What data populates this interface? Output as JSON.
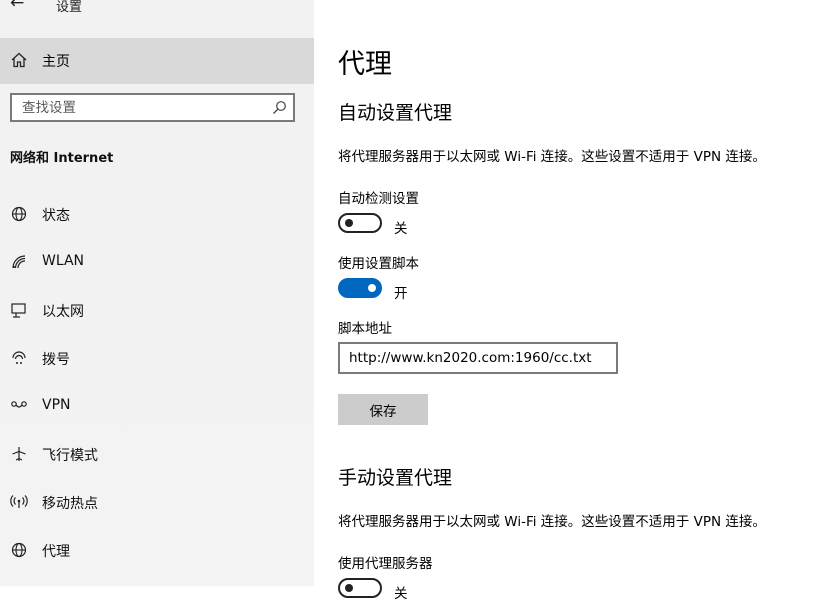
{
  "app": {
    "title": "设置"
  },
  "sidebar": {
    "home_label": "主页",
    "search_placeholder": "查找设置",
    "section_title": "网络和 Internet",
    "items": [
      {
        "label": "状态",
        "icon": "globe-icon"
      },
      {
        "label": "WLAN",
        "icon": "wifi-icon"
      },
      {
        "label": "以太网",
        "icon": "ethernet-icon"
      },
      {
        "label": "拨号",
        "icon": "dialup-icon"
      },
      {
        "label": "VPN",
        "icon": "vpn-icon"
      },
      {
        "label": "飞行模式",
        "icon": "airplane-icon"
      },
      {
        "label": "移动热点",
        "icon": "hotspot-icon"
      },
      {
        "label": "代理",
        "icon": "globe-icon"
      }
    ]
  },
  "main": {
    "page_title": "代理",
    "auto_section": {
      "title": "自动设置代理",
      "description": "将代理服务器用于以太网或 Wi-Fi 连接。这些设置不适用于 VPN 连接。",
      "auto_detect_label": "自动检测设置",
      "auto_detect_state": "关",
      "auto_detect_on": false,
      "script_label": "使用设置脚本",
      "script_state": "开",
      "script_on": true,
      "address_label": "脚本地址",
      "address_value": "http://www.kn2020.com:1960/cc.txt",
      "save_label": "保存"
    },
    "manual_section": {
      "title": "手动设置代理",
      "description": "将代理服务器用于以太网或 Wi-Fi 连接。这些设置不适用于 VPN 连接。",
      "use_proxy_label": "使用代理服务器",
      "use_proxy_state": "关",
      "use_proxy_on": false
    }
  },
  "colors": {
    "accent": "#0067c0",
    "sidebar_bg": "#f2f2f2",
    "selected_bg": "#d9d9d9"
  }
}
